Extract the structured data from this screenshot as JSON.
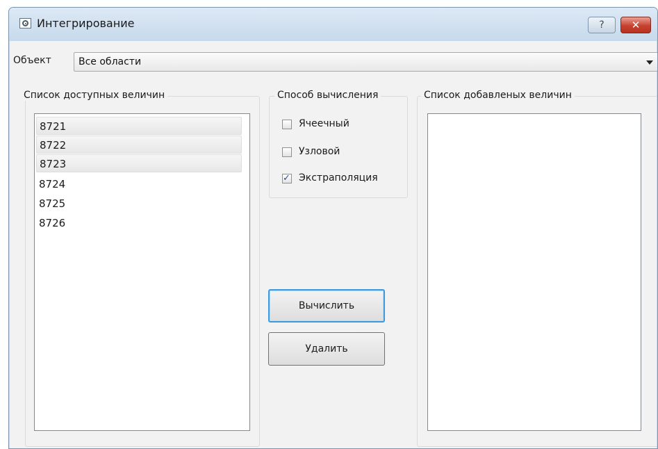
{
  "window": {
    "title": "Интегрирование",
    "help_label": "?",
    "close_label": "✕"
  },
  "object": {
    "label": "Объект",
    "selected": "Все области"
  },
  "available": {
    "title": "Список доступных величин",
    "items": [
      "8721",
      "8722",
      "8723",
      "8724",
      "8725",
      "8726"
    ]
  },
  "method": {
    "title": "Способ вычисления",
    "options": [
      {
        "label": "Ячеечный",
        "checked": false
      },
      {
        "label": "Узловой",
        "checked": false
      },
      {
        "label": "Экстраполяция",
        "checked": true
      }
    ]
  },
  "buttons": {
    "compute": "Вычислить",
    "delete": "Удалить"
  },
  "added": {
    "title": "Список добавленых величин",
    "items": []
  },
  "colors": {
    "focus_border": "#3c9be0",
    "close_red": "#c8412f",
    "check_mark": "#2f4d86"
  }
}
